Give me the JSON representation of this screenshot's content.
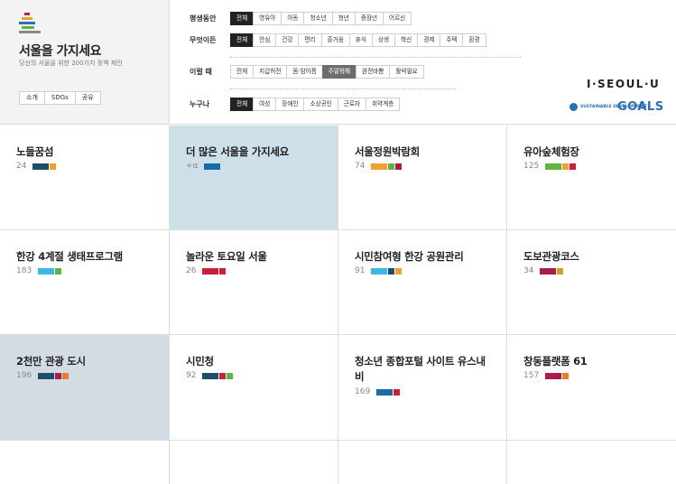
{
  "brand": {
    "title": "서울을 가지세요",
    "subtitle": "당신의 서울을 위한 200가지 정책 제안",
    "buttons": [
      "소개",
      "SDGs",
      "공유"
    ]
  },
  "filters": [
    {
      "label": "평생동안",
      "options": [
        "전체",
        "영유아",
        "아동",
        "청소년",
        "청년",
        "중장년",
        "어르신"
      ],
      "selected": 0
    },
    {
      "label": "무엇이든",
      "options": [
        "전체",
        "안심",
        "건강",
        "편리",
        "즐거움",
        "휴식",
        "상생",
        "혁신",
        "경제",
        "주택",
        "환경"
      ],
      "selected": 0
    },
    {
      "label": "이럴 때",
      "options": [
        "전체",
        "지갑허전",
        "몸·맘아픔",
        "주말뭐해",
        "완전바쁨",
        "활력필요"
      ],
      "selected": 3
    },
    {
      "label": "누구나",
      "options": [
        "전체",
        "여성",
        "장애인",
        "소상공인",
        "근로자",
        "취약계층"
      ],
      "selected": 0
    }
  ],
  "logos": {
    "iseoul": "I·SEOUL·U",
    "sdg_small": "SUSTAINABLE DEVELOPMENT",
    "sdg_goals": "GOALS"
  },
  "colors": {
    "navy": "#1f4e6b",
    "orange": "#f0a030",
    "green": "#5fb33f",
    "red": "#c8203a",
    "crimson": "#a81d4a",
    "blue": "#1a6ca0",
    "cyan": "#3eb8e0",
    "gold": "#c9a227",
    "darkorange": "#ee7a2e",
    "highlight_blue": "#cde0ea",
    "highlight_gray": "#d3dce3"
  },
  "cards": [
    {
      "title": "노들꿈섬",
      "count": "24",
      "bars": [
        "navy",
        "orange"
      ]
    },
    {
      "title": "더 많은 서울을 가지세요",
      "count": "+α",
      "bars": [
        "blue"
      ],
      "bg": "highlight_blue"
    },
    {
      "title": "서울정원박람회",
      "count": "74",
      "bars": [
        "orange",
        "green",
        "crimson"
      ]
    },
    {
      "title": "유아숲체험장",
      "count": "125",
      "bars": [
        "green",
        "orange",
        "red"
      ]
    },
    {
      "title": "한강 4계절 생태프로그램",
      "count": "183",
      "bars": [
        "cyan",
        "green"
      ]
    },
    {
      "title": "놀라운 토요일 서울",
      "count": "26",
      "bars": [
        "red",
        "red"
      ]
    },
    {
      "title": "시민참여형 한강 공원관리",
      "count": "91",
      "bars": [
        "cyan",
        "navy",
        "orange"
      ]
    },
    {
      "title": "도보관광코스",
      "count": "34",
      "bars": [
        "crimson",
        "gold"
      ]
    },
    {
      "title": "2천만 관광 도시",
      "count": "196",
      "bars": [
        "navy",
        "crimson",
        "darkorange"
      ],
      "bg": "highlight_gray"
    },
    {
      "title": "시민청",
      "count": "92",
      "bars": [
        "navy",
        "red",
        "green"
      ]
    },
    {
      "title": "청소년 종합포털 사이트 유스내비",
      "count": "169",
      "bars": [
        "blue",
        "red"
      ]
    },
    {
      "title": "창동플랫폼 61",
      "count": "157",
      "bars": [
        "crimson",
        "darkorange"
      ]
    }
  ]
}
